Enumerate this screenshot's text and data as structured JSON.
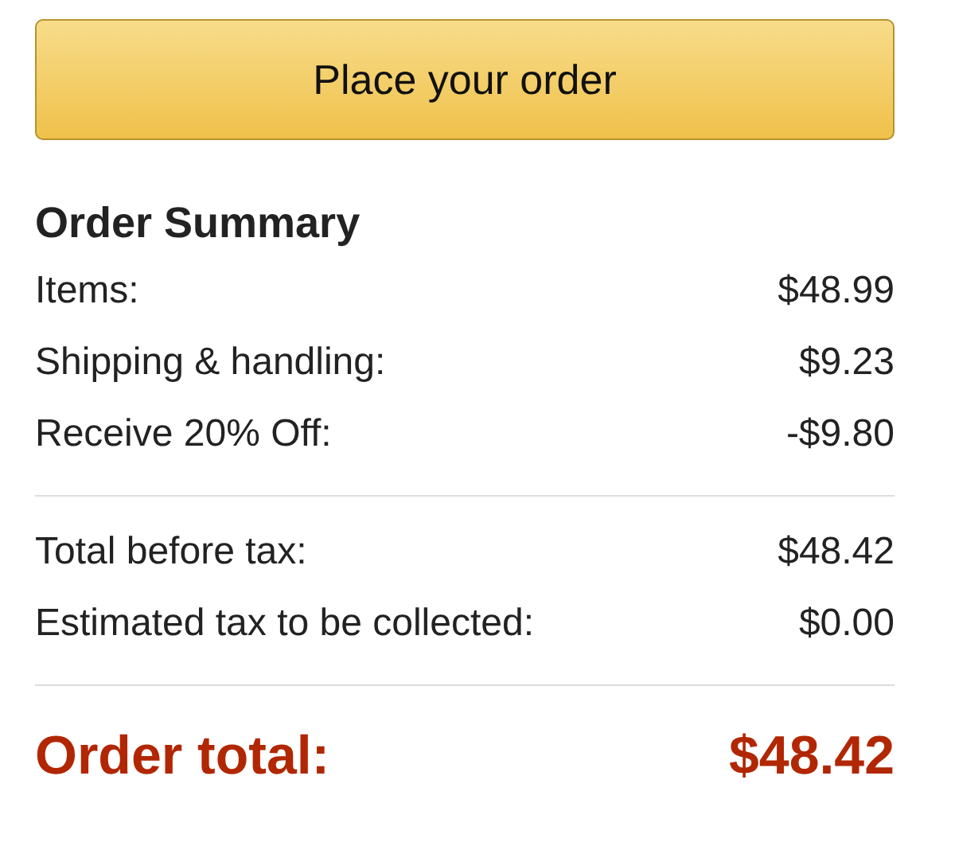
{
  "place_order_button": {
    "label": "Place your order"
  },
  "order_summary": {
    "title": "Order Summary",
    "sections": [
      {
        "rows": [
          {
            "label": "Items:",
            "value": "$48.99"
          },
          {
            "label": "Shipping & handling:",
            "value": "$9.23"
          },
          {
            "label": "Receive 20% Off:",
            "value": "-$9.80"
          }
        ]
      },
      {
        "rows": [
          {
            "label": "Total before tax:",
            "value": "$48.42"
          },
          {
            "label": "Estimated tax to be collected:",
            "value": "$0.00"
          }
        ]
      }
    ],
    "total": {
      "label": "Order total:",
      "value": "$48.42"
    }
  }
}
